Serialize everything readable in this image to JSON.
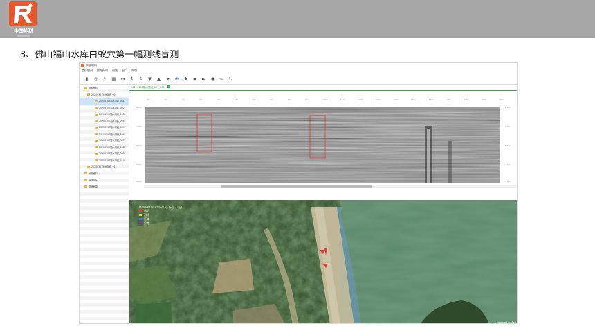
{
  "slide": {
    "title": "3、佛山福山水库白蚁穴第一幅测线盲测",
    "logo_text": "中国地科"
  },
  "app": {
    "window_title": "中国地科",
    "menu": [
      "工作空间",
      "数据处理",
      "视角",
      "窗口",
      "帮助"
    ],
    "toolbar_icons": [
      "new-file-icon",
      "capture-icon",
      "zoom-icon",
      "grid-icon",
      "expand-h-icon",
      "expand-v-icon",
      "compress-v-icon",
      "triangle-down-icon",
      "triangle-up-icon",
      "pointer-icon",
      "crosshair-icon",
      "marker-icon",
      "delete-icon",
      "play-icon",
      "eye-icon",
      "cursor-icon",
      "refresh-icon"
    ],
    "tree": [
      {
        "label": "基本资料",
        "level": 0
      },
      {
        "label": "20200307福水测线_001",
        "level": 1
      },
      {
        "label": "20200307福水测线_001",
        "level": 2,
        "selected": true
      },
      {
        "label": "20200307福水测线_002",
        "level": 2
      },
      {
        "label": "20200307福水测线_003",
        "level": 2
      },
      {
        "label": "20200307福水测线_004",
        "level": 2
      },
      {
        "label": "20200307福水测线_005",
        "level": 2
      },
      {
        "label": "20200307福水测线_006",
        "level": 2
      },
      {
        "label": "20200307福水测线_007",
        "level": 2
      },
      {
        "label": "20200307福水测线_008",
        "level": 2
      },
      {
        "label": "20200307福水测线_009",
        "level": 2
      },
      {
        "label": "20200307福水测线_010",
        "level": 2
      },
      {
        "label": "20200307福水测线_011",
        "level": 1
      },
      {
        "label": "分析资料",
        "level": 0
      },
      {
        "label": "模板文件",
        "level": 0
      },
      {
        "label": "基础资源",
        "level": 0
      }
    ],
    "tab": {
      "label": "20200307福水测线_001_0001"
    },
    "radar": {
      "y_ticks": [
        "0.0m",
        "1.0m",
        "2.0m",
        "3.0m",
        "4.0m"
      ],
      "x_ticks": [
        "0m",
        "1m",
        "2m",
        "3m",
        "4m",
        "5m",
        "6m",
        "7m",
        "8m",
        "9m",
        "10m",
        "11m",
        "12m",
        "13m",
        "14m",
        "15m",
        "16m",
        "17m",
        "18m",
        "19m",
        "20m"
      ]
    },
    "map": {
      "legend_title": "Manhattan Basemap (Sky City)",
      "legend_items": [
        {
          "label": "标记",
          "color": "#e53935"
        },
        {
          "label": "测线",
          "color": "#f1c232"
        },
        {
          "label": "区域",
          "color": "#3c78d8"
        },
        {
          "label": "异常",
          "color": "#9c27b0"
        }
      ],
      "powered": "Powered by Esri"
    }
  }
}
